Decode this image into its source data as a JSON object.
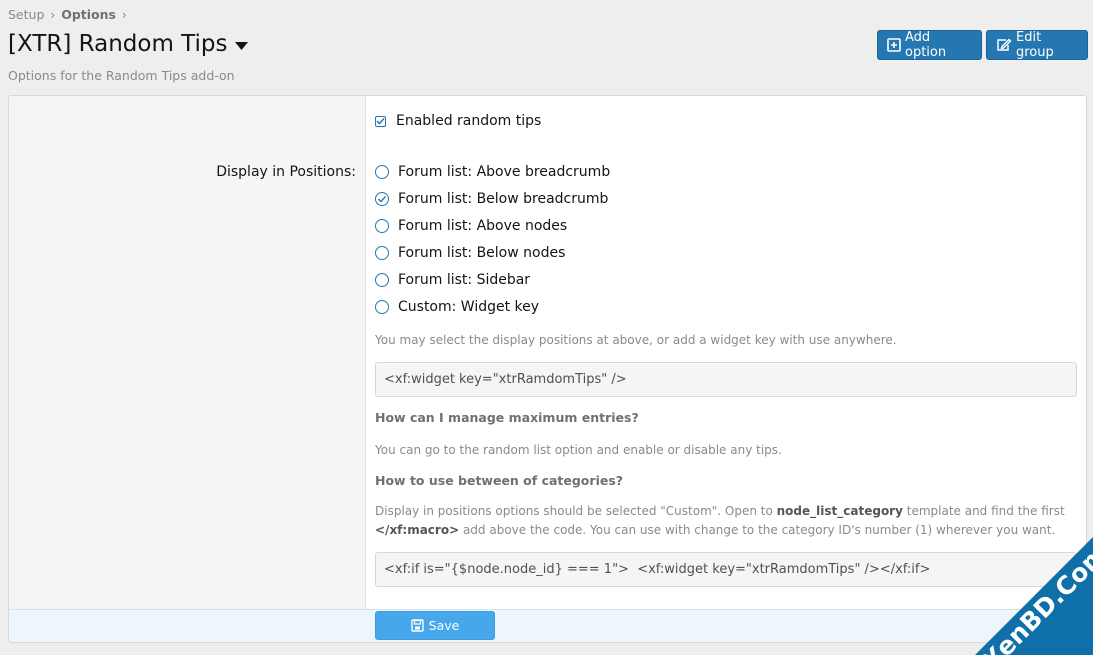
{
  "breadcrumb": {
    "items": [
      "Setup",
      "Options"
    ]
  },
  "page": {
    "title": "[XTR] Random Tips",
    "description": "Options for the Random Tips add-on"
  },
  "toolbar": {
    "add_option_label": "Add option",
    "edit_group_label": "Edit group"
  },
  "form": {
    "enabled_label": "Enabled random tips",
    "enabled_checked": true,
    "positions_label": "Display in Positions:",
    "positions": [
      {
        "label": "Forum list: Above breadcrumb",
        "selected": false
      },
      {
        "label": "Forum list: Below breadcrumb",
        "selected": true
      },
      {
        "label": "Forum list: Above nodes",
        "selected": false
      },
      {
        "label": "Forum list: Below nodes",
        "selected": false
      },
      {
        "label": "Forum list: Sidebar",
        "selected": false
      },
      {
        "label": "Custom: Widget key",
        "selected": false
      }
    ],
    "hint_positions": "You may select the display positions at above, or add a widget key with use anywhere.",
    "widget_code": "<xf:widget key=\"xtrRamdomTips\" />",
    "faq1_title": "How can I manage maximum entries?",
    "faq1_text": "You can go to the random list option and enable or disable any tips.",
    "faq2_title": "How to use between of categories?",
    "faq2_text_1": "Display in positions options should be selected \"Custom\". Open to ",
    "faq2_text_template": "node_list_category",
    "faq2_text_2": " template and find the first ",
    "faq2_text_macro": "</xf:macro>",
    "faq2_text_3": " add above the code. You can use with change to the category ID's number (1) wherever you want.",
    "conditional_code": "<xf:if is=\"{$node.node_id} === 1\">  <xf:widget key=\"xtrRamdomTips\" /></xf:if>",
    "save_label": "Save"
  },
  "watermark": {
    "text": "XenBD.Com"
  },
  "colors": {
    "primary_button": "#2577b1",
    "save_button": "#47a7eb",
    "accent": "#2577b1",
    "watermark": "#0f6fa9"
  },
  "icons": {
    "add_option": "plus-square-icon",
    "edit_group": "edit-icon",
    "title_menu": "caret-down-icon",
    "save": "floppy-disk-icon"
  }
}
